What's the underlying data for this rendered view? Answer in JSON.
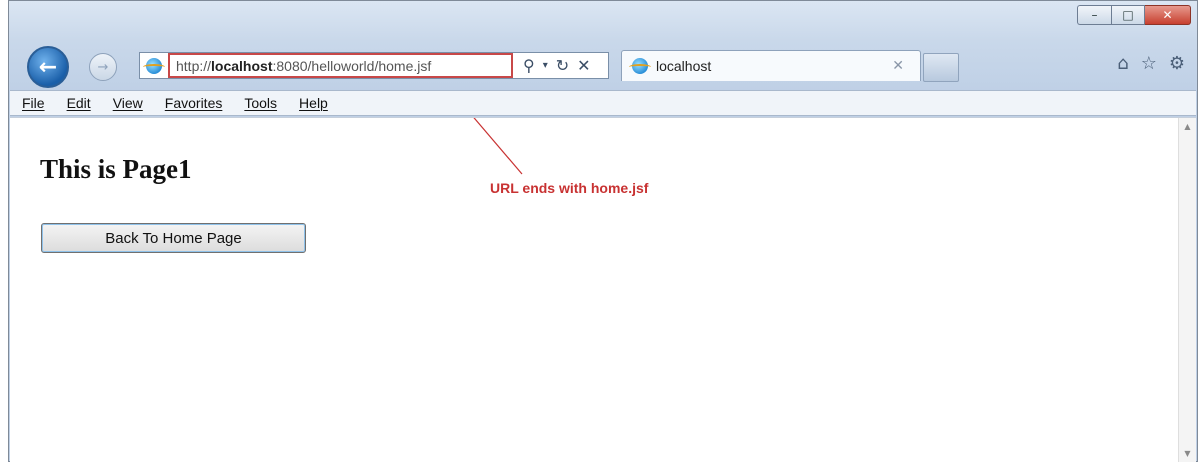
{
  "browser": {
    "address_prefix": "http://",
    "address_host": "localhost",
    "address_rest": ":8080/helloworld/home.jsf",
    "tab_title": "localhost",
    "menu": [
      "File",
      "Edit",
      "View",
      "Favorites",
      "Tools",
      "Help"
    ]
  },
  "page": {
    "heading": "This is Page1",
    "button_label": "Back To Home Page"
  },
  "annotation": {
    "text": "URL ends with home.jsf",
    "color": "#c83232"
  },
  "icons": {
    "back": "back-arrow-icon",
    "forward": "forward-arrow-icon",
    "search": "search-icon",
    "refresh": "refresh-icon",
    "stop": "stop-icon",
    "home": "home-icon",
    "favorites": "star-icon",
    "tools": "gear-icon"
  }
}
